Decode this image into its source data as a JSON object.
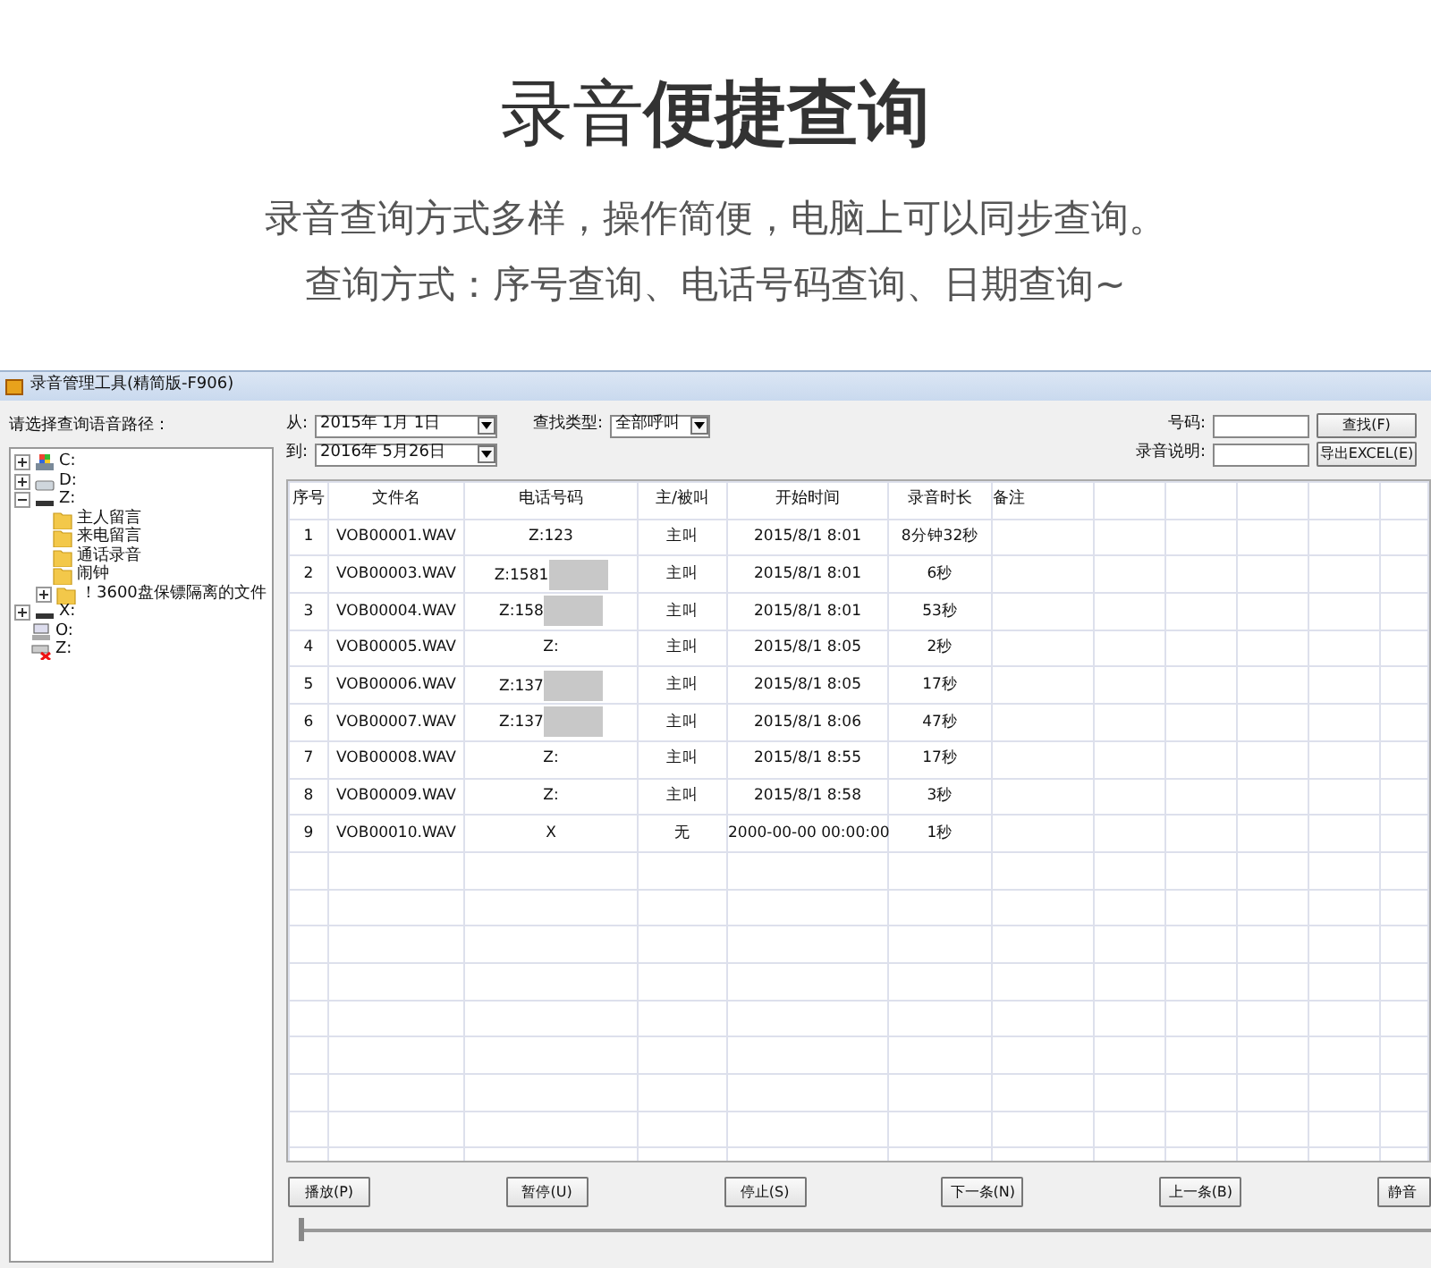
{
  "header": {
    "title": "录音**便捷查询**",
    "lines": [
      "录音查询方式多样，操作简便，电脑上可以同步查询。",
      "查询方式：序号查询、电话号码查询、日期查询~"
    ]
  },
  "window": {
    "title": "录音管理工具(精简版-F906)"
  },
  "sidebar": {
    "label": "请选择查询语音路径：",
    "tree": [
      {
        "label": "C:",
        "kind": "system-drive",
        "expanded": false
      },
      {
        "label": "D:",
        "kind": "drive",
        "expanded": false
      },
      {
        "label": "Z:",
        "kind": "dark-drive",
        "expanded": true,
        "children": [
          {
            "label": "主人留言",
            "kind": "folder"
          },
          {
            "label": "来电留言",
            "kind": "folder"
          },
          {
            "label": "通话录音",
            "kind": "folder"
          },
          {
            "label": "闹钟",
            "kind": "folder"
          },
          {
            "label": "！3600盘保镖隔离的文件",
            "kind": "folder",
            "expanded": false
          }
        ]
      },
      {
        "label": "X:",
        "kind": "dark-drive",
        "expanded": false
      },
      {
        "label": "O:",
        "kind": "network-drive"
      },
      {
        "label": "Z:",
        "kind": "disconnected-drive"
      }
    ]
  },
  "filters": {
    "from_label": "从:",
    "from": "2015年  1月  1日",
    "to_label": "到:",
    "to": "2016年  5月26日",
    "type_label": "查找类型:",
    "type": "全部呼叫",
    "number_label": "号码:",
    "note_label": "录音说明:",
    "search_button": "查找(F)",
    "export_button": "导出EXCEL(E)"
  },
  "table": {
    "columns": [
      "序号",
      "文件名",
      "电话号码",
      "主/被叫",
      "开始时间",
      "录音时长",
      "备注"
    ],
    "rows": [
      {
        "cells": [
          "1",
          "VOB00001.WAV",
          "Z:123",
          "主叫",
          "2015/8/1 8:01",
          "8分钟32秒",
          ""
        ],
        "redacted": false
      },
      {
        "cells": [
          "2",
          "VOB00003.WAV",
          "Z:1581",
          "主叫",
          "2015/8/1 8:01",
          "6秒",
          ""
        ],
        "redacted": true
      },
      {
        "cells": [
          "3",
          "VOB00004.WAV",
          "Z:158",
          "主叫",
          "2015/8/1 8:01",
          "53秒",
          ""
        ],
        "redacted": true
      },
      {
        "cells": [
          "4",
          "VOB00005.WAV",
          "Z:",
          "主叫",
          "2015/8/1 8:05",
          "2秒",
          ""
        ],
        "redacted": false
      },
      {
        "cells": [
          "5",
          "VOB00006.WAV",
          "Z:137",
          "主叫",
          "2015/8/1 8:05",
          "17秒",
          ""
        ],
        "redacted": true
      },
      {
        "cells": [
          "6",
          "VOB00007.WAV",
          "Z:137",
          "主叫",
          "2015/8/1 8:06",
          "47秒",
          ""
        ],
        "redacted": true
      },
      {
        "cells": [
          "7",
          "VOB00008.WAV",
          "Z:",
          "主叫",
          "2015/8/1 8:55",
          "17秒",
          ""
        ],
        "redacted": false
      },
      {
        "cells": [
          "8",
          "VOB00009.WAV",
          "Z:",
          "主叫",
          "2015/8/1 8:58",
          "3秒",
          ""
        ],
        "redacted": false
      },
      {
        "cells": [
          "9",
          "VOB00010.WAV",
          "X",
          "无",
          "2000-00-00 00:00:00",
          "1秒",
          ""
        ],
        "redacted": false
      }
    ]
  },
  "player": {
    "buttons": [
      "播放(P)",
      "暂停(U)",
      "停止(S)",
      "下一条(N)",
      "上一条(B)",
      "静音"
    ],
    "position": {
      "level": 0
    }
  }
}
